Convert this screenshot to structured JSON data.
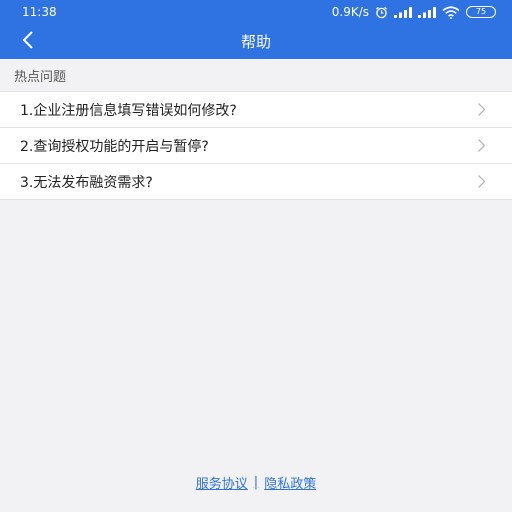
{
  "colors": {
    "header_bg": "#2f73e2",
    "link": "#2f73e2",
    "page_bg": "#f2f2f4",
    "list_bg": "#ffffff"
  },
  "status_bar": {
    "time": "11:38",
    "network_speed": "0.9K/s",
    "battery_level": "75",
    "icons": [
      "alarm-icon",
      "signal-icon",
      "signal-icon",
      "wifi-icon",
      "battery-icon"
    ]
  },
  "nav": {
    "back_icon": "chevron-left-icon",
    "title": "帮助"
  },
  "hot_questions": {
    "section_title": "热点问题",
    "items": [
      {
        "label": "1.企业注册信息填写错误如何修改?"
      },
      {
        "label": "2.查询授权功能的开启与暂停?"
      },
      {
        "label": "3.无法发布融资需求?"
      }
    ]
  },
  "footer": {
    "service_agreement": "服务协议",
    "separator": "|",
    "privacy_policy": "隐私政策"
  }
}
